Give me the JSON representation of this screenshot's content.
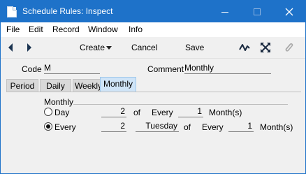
{
  "window": {
    "title": "Schedule Rules: Inspect",
    "controls": {
      "minimize_icon": "minimize-icon",
      "maximize_icon": "maximize-icon",
      "close_icon": "close-icon"
    }
  },
  "menu": {
    "items": [
      "File",
      "Edit",
      "Record",
      "Window",
      "Info"
    ]
  },
  "toolbar": {
    "create_label": "Create",
    "cancel_label": "Cancel",
    "save_label": "Save",
    "icons": [
      "chevron-left-icon",
      "chevron-right-icon",
      "chevron-down-icon",
      "zigzag-icon",
      "expand-arrows-icon",
      "paperclip-icon"
    ]
  },
  "header": {
    "code_label": "Code",
    "code_value": "M",
    "comment_label": "Comment",
    "comment_value": "Monthly"
  },
  "tabs": [
    {
      "label": "Period",
      "active": false
    },
    {
      "label": "Daily",
      "active": false
    },
    {
      "label": "Weekly",
      "active": false
    },
    {
      "label": "Monthly",
      "active": true
    }
  ],
  "monthly": {
    "group_label": "Monthly",
    "day_row": {
      "radio_label": "Day",
      "selected": false,
      "day_value": "2",
      "of_label": "of",
      "every_label": "Every",
      "months_value": "1",
      "months_label": "Month(s)"
    },
    "every_row": {
      "radio_label": "Every",
      "selected": true,
      "nth_value": "2",
      "weekday_value": "Tuesday",
      "of_label": "of",
      "every_label": "Every",
      "months_value": "1",
      "months_label": "Month(s)"
    }
  },
  "colors": {
    "titlebar": "#1e72c9",
    "active_tab": "#cfe4f7",
    "background": "#f0f0f0"
  }
}
